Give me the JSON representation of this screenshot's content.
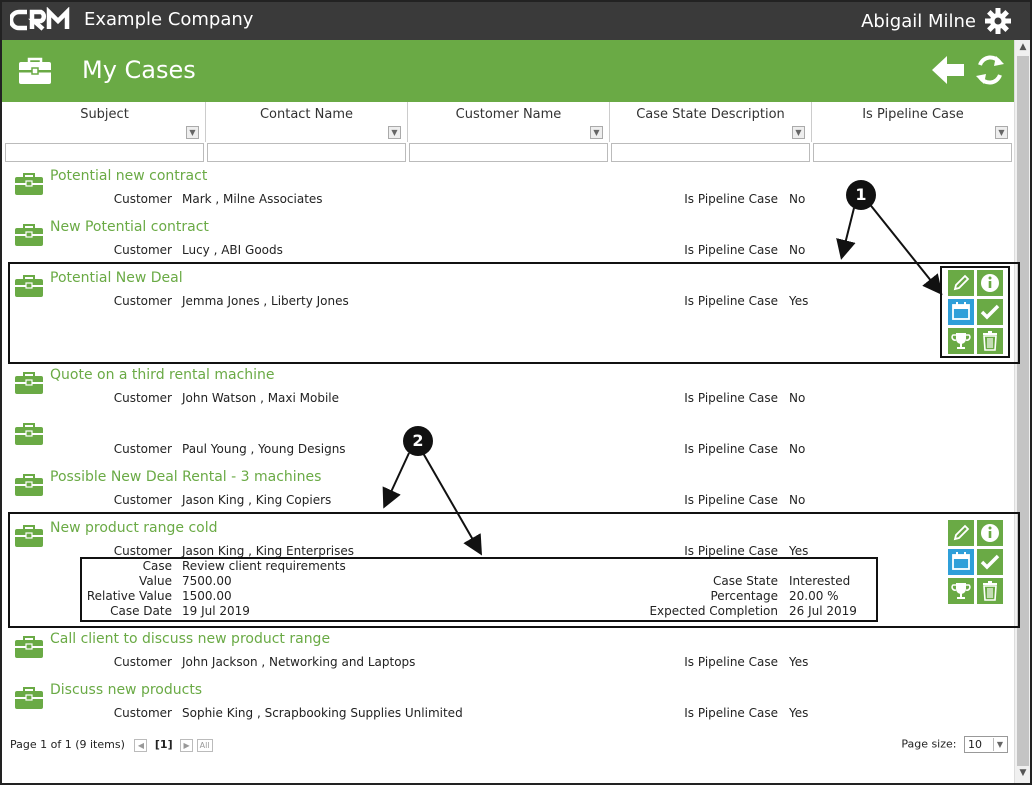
{
  "app": {
    "company": "Example Company",
    "user": "Abigail Milne"
  },
  "header": {
    "title": "My Cases",
    "accent": "#6aaa45"
  },
  "columns": [
    {
      "label": "Subject"
    },
    {
      "label": "Contact Name"
    },
    {
      "label": "Customer Name"
    },
    {
      "label": "Case State Description"
    },
    {
      "label": "Is Pipeline Case"
    }
  ],
  "labels": {
    "customer": "Customer",
    "pipeline": "Is Pipeline Case",
    "case": "Case",
    "value": "Value",
    "relative_value": "Relative Value",
    "case_date": "Case Date",
    "case_state": "Case State",
    "percentage": "Percentage",
    "expected_completion": "Expected Completion"
  },
  "rows": [
    {
      "subject": "Potential new contract",
      "customer": "Mark , Milne Associates",
      "pipeline": "No"
    },
    {
      "subject": "New Potential contract",
      "customer": "Lucy , ABI Goods",
      "pipeline": "No"
    },
    {
      "subject": "Potential New Deal",
      "customer": "Jemma Jones , Liberty Jones",
      "pipeline": "Yes"
    },
    {
      "subject": "Quote on a third rental machine",
      "customer": "John Watson , Maxi Mobile",
      "pipeline": "No"
    },
    {
      "subject": "",
      "customer": "Paul Young , Young Designs",
      "pipeline": "No"
    },
    {
      "subject": "Possible New Deal Rental - 3 machines",
      "customer": "Jason King , King Copiers",
      "pipeline": "No"
    },
    {
      "subject": "New product range cold",
      "customer": "Jason King , King Enterprises",
      "pipeline": "Yes"
    },
    {
      "subject": "Call client to discuss new product range",
      "customer": "John Jackson , Networking and Laptops",
      "pipeline": "Yes"
    },
    {
      "subject": "Discuss new products",
      "customer": "Sophie King , Scrapbooking Supplies Unlimited",
      "pipeline": "Yes"
    }
  ],
  "details": {
    "case": "Review client requirements",
    "value": "7500.00",
    "relative_value": "1500.00",
    "case_date": "19 Jul 2019",
    "case_state": "Interested",
    "percentage": "20.00 %",
    "expected_completion": "26 Jul 2019"
  },
  "callouts": [
    "1",
    "2"
  ],
  "pager": {
    "info": "Page 1 of 1 (9 items)",
    "current": "[1]",
    "all": "All",
    "size_label": "Page size:",
    "size_value": "10"
  },
  "icons": [
    "gear-icon",
    "briefcase-icon",
    "back-arrow-icon",
    "refresh-icon",
    "edit-icon",
    "info-icon",
    "calendar-icon",
    "check-icon",
    "trophy-icon",
    "trash-icon"
  ]
}
